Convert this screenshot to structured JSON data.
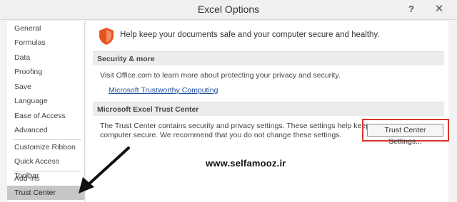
{
  "window": {
    "title": "Excel Options",
    "help_glyph": "?",
    "close_glyph": "✕"
  },
  "sidebar": {
    "items": [
      {
        "label": "General"
      },
      {
        "label": "Formulas"
      },
      {
        "label": "Data"
      },
      {
        "label": "Proofing"
      },
      {
        "label": "Save"
      },
      {
        "label": "Language"
      },
      {
        "label": "Ease of Access"
      },
      {
        "label": "Advanced"
      },
      {
        "label": "Customize Ribbon"
      },
      {
        "label": "Quick Access Toolbar"
      },
      {
        "label": "Add-ins"
      },
      {
        "label": "Trust Center",
        "active": true
      }
    ]
  },
  "main": {
    "header": "Help keep your documents safe and your computer secure and healthy.",
    "security": {
      "heading": "Security & more",
      "description": "Visit Office.com to learn more about protecting your privacy and security.",
      "link": "Microsoft Trustworthy Computing"
    },
    "trust_center": {
      "heading": "Microsoft Excel Trust Center",
      "description_line1": "The Trust Center contains security and privacy settings. These settings help keep your",
      "description_line2": "computer secure. We recommend that you do not change these settings.",
      "button": "Trust Center Settings..."
    }
  },
  "watermark": "www.selfamooz.ir",
  "colors": {
    "highlight_box": "#d9342b",
    "shield": "#e8541e",
    "link": "#1f4e9c",
    "active_nav": "#c6c6c6"
  }
}
